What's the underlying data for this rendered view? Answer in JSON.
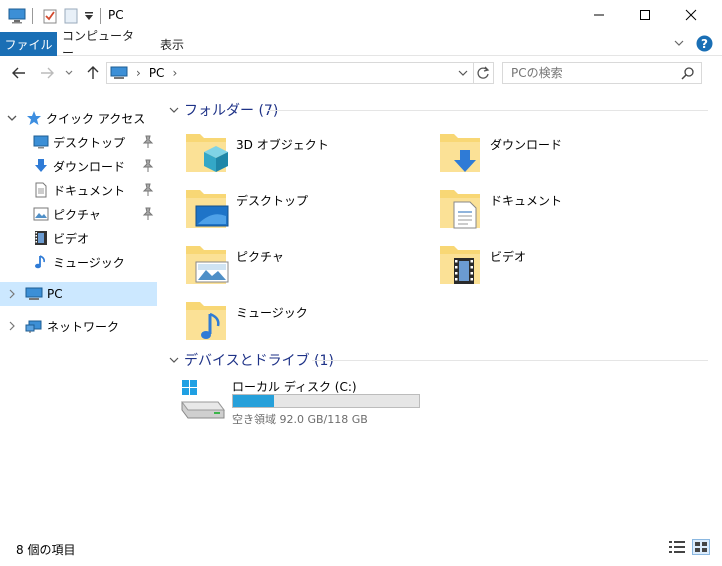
{
  "window": {
    "title": "PC",
    "minimize_glyph": "—",
    "maximize_glyph": "☐",
    "close_glyph": "✕"
  },
  "ribbon": {
    "tabs": [
      {
        "label": "ファイル",
        "active": true
      },
      {
        "label": "コンピューター",
        "active": false
      },
      {
        "label": "表示",
        "active": false
      }
    ],
    "expand_glyph": "∨",
    "help_glyph": "?"
  },
  "address": {
    "back_glyph": "←",
    "forward_glyph": "→",
    "recent_glyph": "∨",
    "up_glyph": "↑",
    "separator": "›",
    "location": "PC",
    "trail_separator": "›",
    "dropdown_glyph": "∨",
    "refresh_glyph": "↻"
  },
  "search": {
    "placeholder": "PCの検索",
    "value": ""
  },
  "nav": {
    "quick_access": "クイック アクセス",
    "quick_items": [
      {
        "label": "デスクトップ",
        "icon": "desktop-icon",
        "pinned": true
      },
      {
        "label": "ダウンロード",
        "icon": "download-icon",
        "pinned": true
      },
      {
        "label": "ドキュメント",
        "icon": "document-icon",
        "pinned": true
      },
      {
        "label": "ピクチャ",
        "icon": "picture-icon",
        "pinned": true
      },
      {
        "label": "ビデオ",
        "icon": "video-icon",
        "pinned": false
      },
      {
        "label": "ミュージック",
        "icon": "music-icon",
        "pinned": false
      }
    ],
    "pc": "PC",
    "network": "ネットワーク",
    "expand_glyph": "›",
    "collapse_glyph": "∨"
  },
  "content": {
    "folders_header": "フォルダー (7)",
    "folders": [
      {
        "label": "3D オブジェクト",
        "icon": "3d-objects-icon"
      },
      {
        "label": "ダウンロード",
        "icon": "downloads-folder-icon"
      },
      {
        "label": "デスクトップ",
        "icon": "desktop-folder-icon"
      },
      {
        "label": "ドキュメント",
        "icon": "documents-folder-icon"
      },
      {
        "label": "ピクチャ",
        "icon": "pictures-folder-icon"
      },
      {
        "label": "ビデオ",
        "icon": "videos-folder-icon"
      },
      {
        "label": "ミュージック",
        "icon": "music-folder-icon"
      }
    ],
    "devices_header": "デバイスとドライブ (1)",
    "drive": {
      "name": "ローカル ディスク (C:)",
      "free_text": "空き領域 92.0 GB/118 GB",
      "used_fraction": 0.22,
      "bar_color": "#26a0da"
    }
  },
  "status": {
    "item_count": "8 個の項目"
  },
  "colors": {
    "accent": "#1a6fb5",
    "selection": "#cce8ff",
    "group_header": "#1e3287",
    "folder": "#f8d775"
  }
}
